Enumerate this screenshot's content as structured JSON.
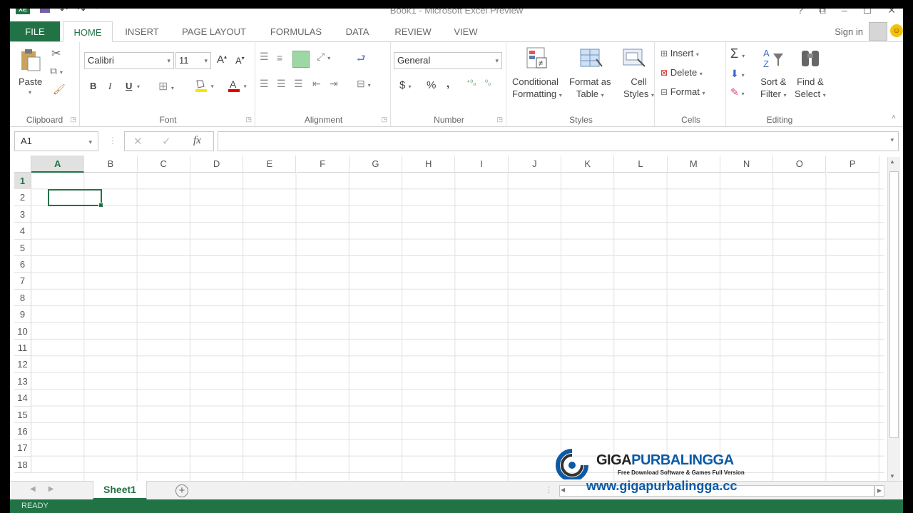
{
  "window": {
    "title": "Book1 - Microsoft Excel Preview",
    "sign_in": "Sign in",
    "app_badge": "XE"
  },
  "tabs": [
    "FILE",
    "HOME",
    "INSERT",
    "PAGE LAYOUT",
    "FORMULAS",
    "DATA",
    "REVIEW",
    "VIEW"
  ],
  "active_tab": "HOME",
  "ribbon": {
    "clipboard": {
      "paste": "Paste",
      "label": "Clipboard"
    },
    "font": {
      "family": "Calibri",
      "size": "11",
      "bold": "B",
      "italic": "I",
      "underline": "U",
      "label": "Font"
    },
    "alignment": {
      "label": "Alignment"
    },
    "number": {
      "format": "General",
      "currency": "$",
      "percent": "%",
      "comma": ",",
      "label": "Number"
    },
    "styles": {
      "conditional_1": "Conditional",
      "conditional_2": "Formatting",
      "format_table_1": "Format as",
      "format_table_2": "Table",
      "cell_styles_1": "Cell",
      "cell_styles_2": "Styles",
      "label": "Styles"
    },
    "cells": {
      "insert": "Insert",
      "delete": "Delete",
      "format": "Format",
      "label": "Cells"
    },
    "editing": {
      "sort_1": "Sort &",
      "sort_2": "Filter",
      "find_1": "Find &",
      "find_2": "Select",
      "label": "Editing"
    }
  },
  "formula_bar": {
    "name_box": "A1",
    "fx": "fx",
    "value": ""
  },
  "grid": {
    "columns": [
      "A",
      "B",
      "C",
      "D",
      "E",
      "F",
      "G",
      "H",
      "I",
      "J",
      "K",
      "L",
      "M",
      "N",
      "O",
      "P"
    ],
    "rows": [
      "1",
      "2",
      "3",
      "4",
      "5",
      "6",
      "7",
      "8",
      "9",
      "10",
      "11",
      "12",
      "13",
      "14",
      "15",
      "16",
      "17",
      "18"
    ],
    "selected_column": "A",
    "selected_row": "1"
  },
  "sheets": [
    "Sheet1"
  ],
  "status": "READY",
  "watermark": {
    "brand_a": "GIGA",
    "brand_b": "PURBALINGGA",
    "tagline": "Free Download Software & Games Full Version",
    "url": "www.gigapurbalingga.cc"
  },
  "colors": {
    "accent": "#217346",
    "watermark_blue": "#0b5aa6"
  }
}
